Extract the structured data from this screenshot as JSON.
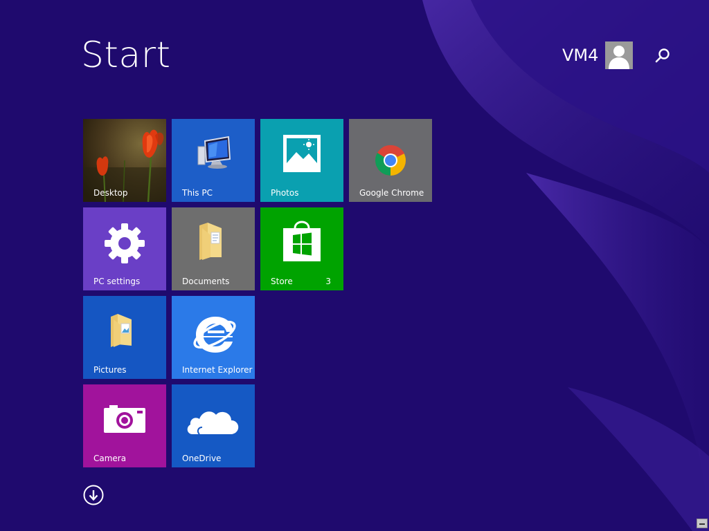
{
  "screen": {
    "title": "Start"
  },
  "user": {
    "name": "VM4",
    "avatar_icon": "user-avatar-icon"
  },
  "search": {
    "icon": "search-icon"
  },
  "tiles": [
    {
      "label": "Desktop",
      "color": "#6b4a2a",
      "icon": "tulip-wallpaper-image"
    },
    {
      "label": "This PC",
      "color": "#1d5ec8",
      "icon": "computer-monitor-icon"
    },
    {
      "label": "Photos",
      "color": "#0aa0b0",
      "icon": "photo-landscape-icon"
    },
    {
      "label": "Google Chrome",
      "color": "#6a6a6e",
      "icon": "chrome-logo-icon"
    },
    {
      "label": "PC settings",
      "color": "#6a3fc6",
      "icon": "gear-icon"
    },
    {
      "label": "Documents",
      "color": "#6e6e6e",
      "icon": "documents-folder-icon"
    },
    {
      "label": "Store",
      "color": "#00a300",
      "icon": "store-bag-icon",
      "badge": "3"
    },
    {
      "label": "Pictures",
      "color": "#1556c2",
      "icon": "pictures-folder-icon"
    },
    {
      "label": "Internet Explorer",
      "color": "#2b7ae8",
      "icon": "internet-explorer-icon"
    },
    {
      "label": "Camera",
      "color": "#a1139c",
      "icon": "camera-icon"
    },
    {
      "label": "OneDrive",
      "color": "#1559c4",
      "icon": "onedrive-cloud-icon"
    }
  ],
  "apps_view": {
    "icon": "down-arrow-circle-icon"
  }
}
